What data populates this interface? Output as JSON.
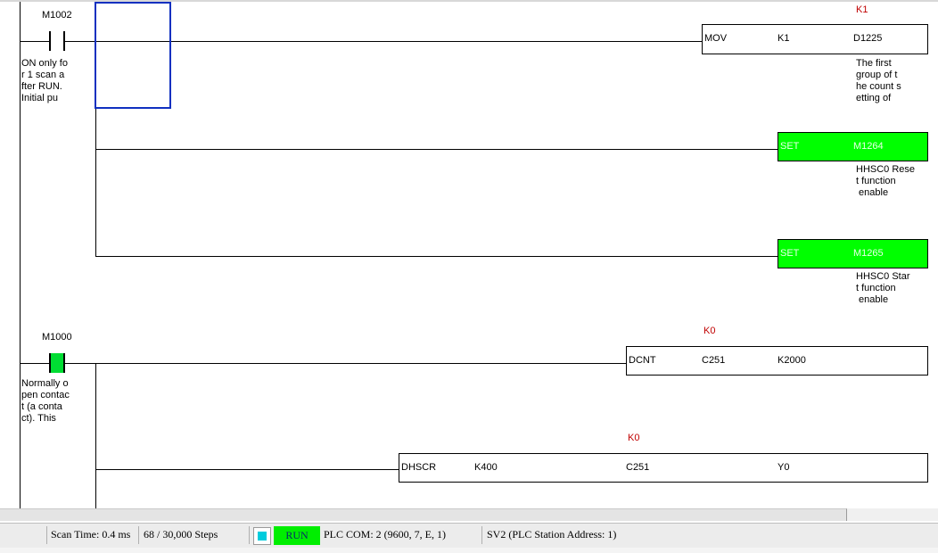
{
  "rungs": [
    {
      "contact": {
        "device": "M1002",
        "comment": "ON only fo\nr 1 scan a\nfter RUN.\nInitial pu"
      },
      "instructions": [
        {
          "mnemonic": "MOV",
          "operands": [
            "K1",
            "D1225"
          ],
          "above": "K1",
          "comment": "The first\ngroup of t\nhe count s\netting of",
          "active": false
        },
        {
          "mnemonic": "SET",
          "operands": [
            "M1264"
          ],
          "comment": "HHSC0 Rese\nt function\n enable",
          "active": true
        },
        {
          "mnemonic": "SET",
          "operands": [
            "M1265"
          ],
          "comment": "HHSC0 Star\nt function\n enable",
          "active": true
        }
      ]
    },
    {
      "contact": {
        "device": "M1000",
        "comment": "Normally o\npen contac\nt (a conta\nct). This",
        "energized": true
      },
      "instructions": [
        {
          "mnemonic": "DCNT",
          "operands": [
            "C251",
            "K2000"
          ],
          "above": "K0",
          "active": false
        },
        {
          "mnemonic": "DHSCR",
          "operands": [
            "K400",
            "C251",
            "Y0"
          ],
          "above": "K0",
          "active": false
        }
      ]
    }
  ],
  "status_bar": {
    "scan_time": "Scan Time: 0.4 ms",
    "steps": "68 / 30,000 Steps",
    "run_state": "RUN",
    "plc_com": "PLC COM: 2 (9600, 7, E, 1)",
    "station": "SV2 (PLC Station Address: 1)"
  },
  "colors": {
    "active_instruction": "#00ff00",
    "energized_contact": "#00dd33",
    "run_badge": "#00ee00",
    "selection_cursor": "#1030c0",
    "monitor_value": "#c00000"
  }
}
